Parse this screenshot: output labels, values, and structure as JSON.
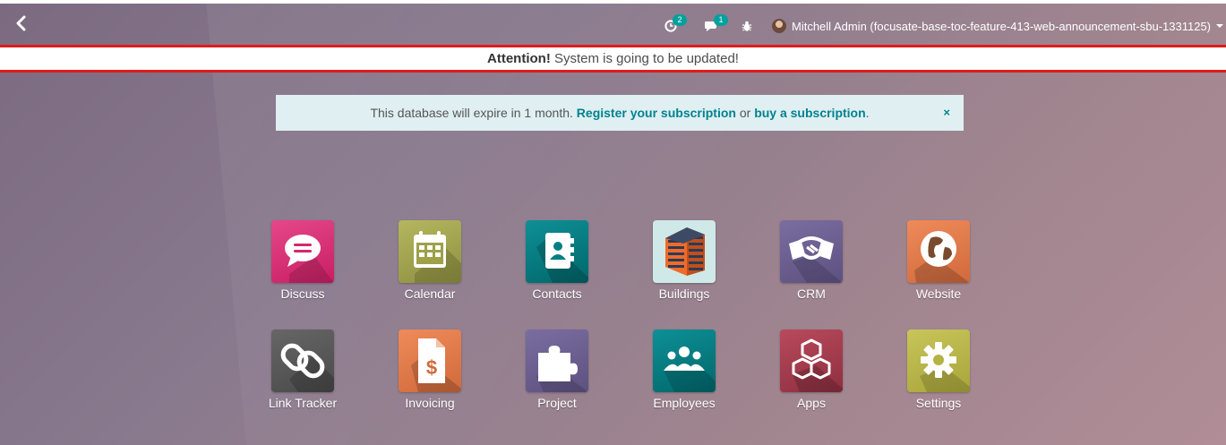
{
  "topbar": {
    "back_icon": "chevron-left-icon",
    "activity_badge": "2",
    "messages_badge": "1",
    "user_name": "Mitchell Admin (focusate-base-toc-feature-413-web-announcement-sbu-1331125)"
  },
  "announcement": {
    "strong": "Attention!",
    "text": " System is going to be updated!"
  },
  "expiry": {
    "text": "This database will expire in 1 month. ",
    "register_link": "Register your subscription",
    "or": " or ",
    "buy_link": "buy a subscription",
    "period": ".",
    "close": "×"
  },
  "apps": [
    {
      "label": "Discuss",
      "icon": "chat-bubble-icon",
      "color": "#d6256f"
    },
    {
      "label": "Calendar",
      "icon": "calendar-icon",
      "color": "#9ea04a"
    },
    {
      "label": "Contacts",
      "icon": "address-book-icon",
      "color": "#017e84"
    },
    {
      "label": "Buildings",
      "icon": "building-icon",
      "color": "#cfe9e9"
    },
    {
      "label": "CRM",
      "icon": "handshake-icon",
      "color": "#6b5e8e"
    },
    {
      "label": "Website",
      "icon": "globe-icon",
      "color": "#e07a4a"
    },
    {
      "label": "Link Tracker",
      "icon": "link-icon",
      "color": "#555555"
    },
    {
      "label": "Invoicing",
      "icon": "invoice-icon",
      "color": "#e07a4a"
    },
    {
      "label": "Project",
      "icon": "puzzle-icon",
      "color": "#6b5e8e"
    },
    {
      "label": "Employees",
      "icon": "users-icon",
      "color": "#017e84"
    },
    {
      "label": "Apps",
      "icon": "cubes-icon",
      "color": "#a33b4c"
    },
    {
      "label": "Settings",
      "icon": "gear-icon",
      "color": "#b6b345"
    }
  ]
}
